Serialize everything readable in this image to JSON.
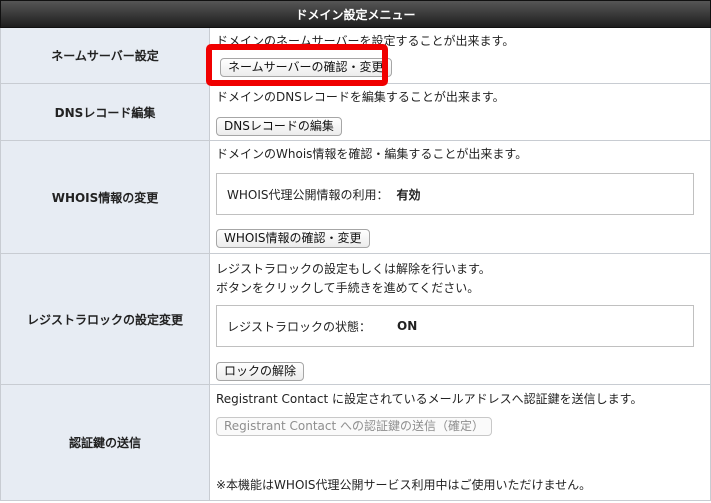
{
  "header": {
    "title": "ドメイン設定メニュー"
  },
  "rows": {
    "nameserver": {
      "label": "ネームサーバー設定",
      "description": "ドメインのネームサーバーを設定することが出来ます。",
      "button": "ネームサーバーの確認・変更"
    },
    "dns": {
      "label": "DNSレコード編集",
      "description": "ドメインのDNSレコードを編集することが出来ます。",
      "button": "DNSレコードの編集"
    },
    "whois": {
      "label": "WHOIS情報の変更",
      "description": "ドメインのWhois情報を確認・編集することが出来ます。",
      "status_label": "WHOIS代理公開情報の利用：",
      "status_value": "有効",
      "button": "WHOIS情報の確認・変更"
    },
    "lock": {
      "label": "レジストラロックの設定変更",
      "description_1": "レジストラロックの設定もしくは解除を行います。",
      "description_2": "ボタンをクリックして手続きを進めてください。",
      "status_label": "レジストラロックの状態：",
      "status_value": "ON",
      "button": "ロックの解除"
    },
    "authkey": {
      "label": "認証鍵の送信",
      "description": "Registrant Contact に設定されているメールアドレスへ認証鍵を送信します。",
      "button": "Registrant Contact への認証鍵の送信（確定）",
      "note": "※本機能はWHOIS代理公開サービス利用中はご使用いただけません。"
    }
  },
  "highlight_color": "#f00000"
}
